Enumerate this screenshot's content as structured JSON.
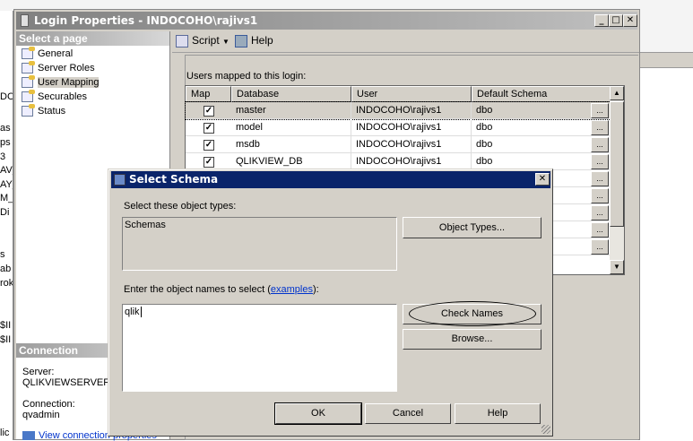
{
  "background_fragments": [
    "DC",
    "as",
    "ps",
    "3",
    "AV_",
    "AY_",
    "M_",
    "Di",
    "s",
    "ab",
    "rok",
    "$II",
    "$II",
    "lic"
  ],
  "login_window": {
    "title": "Login Properties - INDOCOHO\\rajivs1",
    "select_page_header": "Select a page",
    "pages": [
      "General",
      "Server Roles",
      "User Mapping",
      "Securables",
      "Status"
    ],
    "selected_page": "User Mapping",
    "toolbar": {
      "script_label": "Script",
      "help_label": "Help"
    },
    "users_mapped_label": "Users mapped to this login:",
    "grid": {
      "columns": [
        "Map",
        "Database",
        "User",
        "Default Schema"
      ],
      "rows": [
        {
          "map": true,
          "database": "master",
          "user": "INDOCOHO\\rajivs1",
          "schema": "dbo"
        },
        {
          "map": true,
          "database": "model",
          "user": "INDOCOHO\\rajivs1",
          "schema": "dbo"
        },
        {
          "map": true,
          "database": "msdb",
          "user": "INDOCOHO\\rajivs1",
          "schema": "dbo"
        },
        {
          "map": true,
          "database": "QLIKVIEW_DB",
          "user": "INDOCOHO\\rajivs1",
          "schema": "dbo"
        }
      ],
      "ellipsis": "..."
    },
    "connection": {
      "header": "Connection",
      "server_label": "Server:",
      "server_value": "QLIKVIEWSERVEF",
      "connection_label": "Connection:",
      "connection_value": "qvadmin",
      "view_link": "View connection properties"
    }
  },
  "select_schema_dialog": {
    "title": "Select Schema",
    "object_types_label": "Select these object types:",
    "object_types_value": "Schemas",
    "object_types_button": "Object Types...",
    "enter_names_label": "Enter the object names to select (",
    "examples_link": "examples",
    "enter_names_suffix": "):",
    "names_value": "qlik",
    "check_names_button": "Check Names",
    "browse_button": "Browse...",
    "ok_button": "OK",
    "cancel_button": "Cancel",
    "help_button": "Help"
  }
}
